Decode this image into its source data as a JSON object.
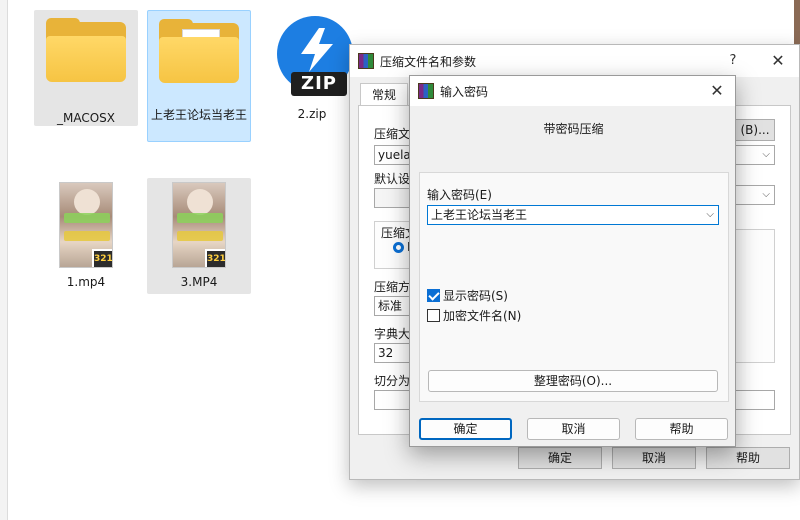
{
  "desktop": {
    "items": [
      {
        "label": "_MACOSX",
        "type": "folder"
      },
      {
        "label": "上老王论坛当老王",
        "type": "folder"
      },
      {
        "label": "2.zip",
        "type": "zip",
        "badge": "ZIP"
      },
      {
        "label": "1.mp4",
        "type": "video",
        "badge": "321"
      },
      {
        "label": "3.MP4",
        "type": "video",
        "badge": "321"
      }
    ]
  },
  "bg_dialog": {
    "title": "压缩文件名和参数",
    "help": "?",
    "close": "✕",
    "tab_general": "常规",
    "archive_label": "压缩文",
    "archive_value": "yuelan",
    "browse_button": "(B)...",
    "default_label": "默认设",
    "format_label": "压缩文",
    "radio_label": "R",
    "method_label": "压缩方",
    "method_value": "标准",
    "dict_label": "字典大",
    "dict_value": "32",
    "split_label": "切分为",
    "ok_button": "确定",
    "cancel_button": "取消",
    "help_button": "帮助"
  },
  "fg_dialog": {
    "title": "输入密码",
    "close": "✕",
    "heading": "带密码压缩",
    "password_label": "输入密码(E)",
    "password_value": "上老王论坛当老王",
    "show_password_label": "显示密码(S)",
    "show_password_checked": true,
    "encrypt_names_label": "加密文件名(N)",
    "encrypt_names_checked": false,
    "organize_button": "整理密码(O)...",
    "ok_button": "确定",
    "cancel_button": "取消",
    "help_button": "帮助"
  },
  "colors": {
    "accent": "#0078d4",
    "folder": "#f6c443",
    "zip_blue": "#1d7ee2"
  }
}
